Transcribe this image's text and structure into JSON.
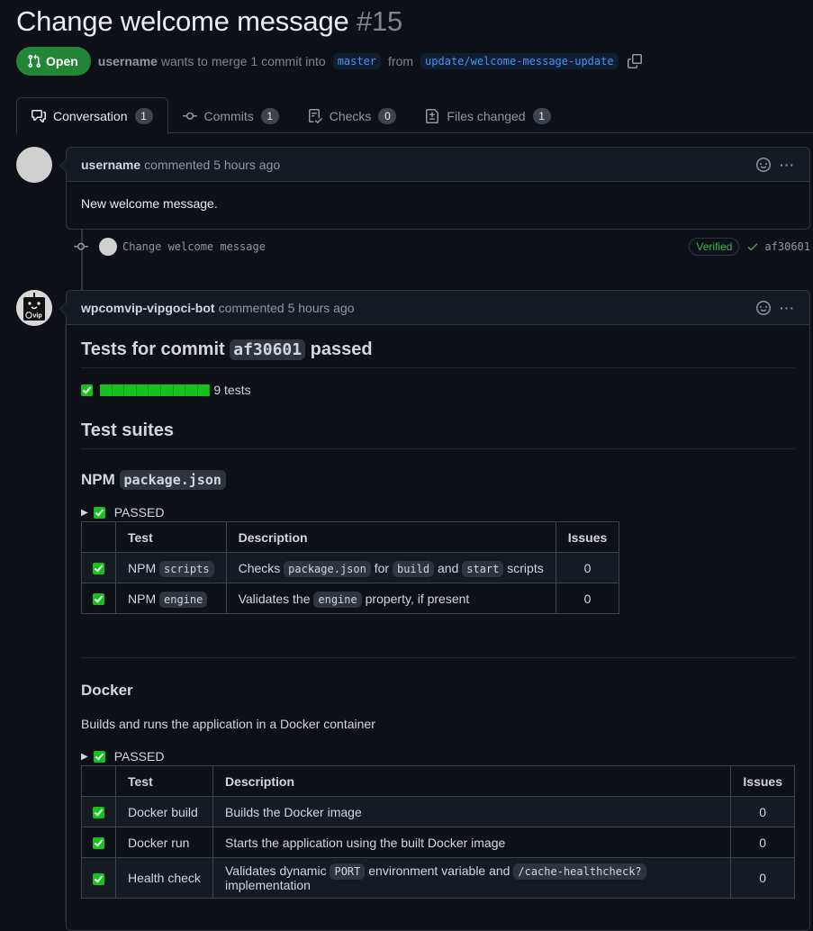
{
  "pr": {
    "title": "Change welcome message",
    "number": "#15",
    "state": "Open",
    "author": "username",
    "merge_text": "wants to merge 1 commit into",
    "base_branch": "master",
    "from_text": "from",
    "head_branch": "update/welcome-message-update"
  },
  "tabs": [
    {
      "label": "Conversation",
      "count": "1",
      "icon": "comment-discussion-icon",
      "active": true
    },
    {
      "label": "Commits",
      "count": "1",
      "icon": "git-commit-icon"
    },
    {
      "label": "Checks",
      "count": "0",
      "icon": "checklist-icon"
    },
    {
      "label": "Files changed",
      "count": "1",
      "icon": "file-diff-icon"
    }
  ],
  "comment1": {
    "author": "username",
    "meta": "commented 5 hours ago",
    "body": "New welcome message."
  },
  "commit": {
    "message": "Change welcome message",
    "badge": "Verified",
    "sha": "af30601"
  },
  "comment2": {
    "author": "wpcomvip-vipgoci-bot",
    "meta": "commented 5 hours ago",
    "heading_pre": "Tests for commit",
    "heading_sha": "af30601",
    "heading_post": "passed",
    "progress": {
      "passed": 9,
      "total": 9,
      "label": "9 tests"
    },
    "suites_heading": "Test suites",
    "suites": [
      {
        "title_pre": "NPM",
        "title_code": "package.json",
        "status": "PASSED",
        "columns": [
          "",
          "Test",
          "Description",
          "Issues"
        ],
        "rows": [
          {
            "test": [
              {
                "t": "NPM "
              },
              {
                "c": "scripts"
              }
            ],
            "desc": [
              {
                "t": "Checks "
              },
              {
                "c": "package.json"
              },
              {
                "t": " for "
              },
              {
                "c": "build"
              },
              {
                "t": " and "
              },
              {
                "c": "start"
              },
              {
                "t": " scripts"
              }
            ],
            "issues": "0"
          },
          {
            "test": [
              {
                "t": "NPM "
              },
              {
                "c": "engine"
              }
            ],
            "desc": [
              {
                "t": "Validates the "
              },
              {
                "c": "engine"
              },
              {
                "t": " property, if present"
              }
            ],
            "issues": "0"
          }
        ]
      },
      {
        "title_pre": "Docker",
        "description": "Builds and runs the application in a Docker container",
        "status": "PASSED",
        "columns": [
          "",
          "Test",
          "Description",
          "Issues"
        ],
        "rows": [
          {
            "test": [
              {
                "t": "Docker build"
              }
            ],
            "desc": [
              {
                "t": "Builds the Docker image"
              }
            ],
            "issues": "0"
          },
          {
            "test": [
              {
                "t": "Docker run"
              }
            ],
            "desc": [
              {
                "t": "Starts the application using the built Docker image"
              }
            ],
            "issues": "0"
          },
          {
            "test": [
              {
                "t": "Health check"
              }
            ],
            "desc": [
              {
                "t": "Validates dynamic "
              },
              {
                "c": "PORT"
              },
              {
                "t": " environment variable and "
              },
              {
                "c": "/cache-healthcheck?"
              },
              {
                "t": " implementation"
              }
            ],
            "issues": "0"
          }
        ]
      }
    ]
  }
}
